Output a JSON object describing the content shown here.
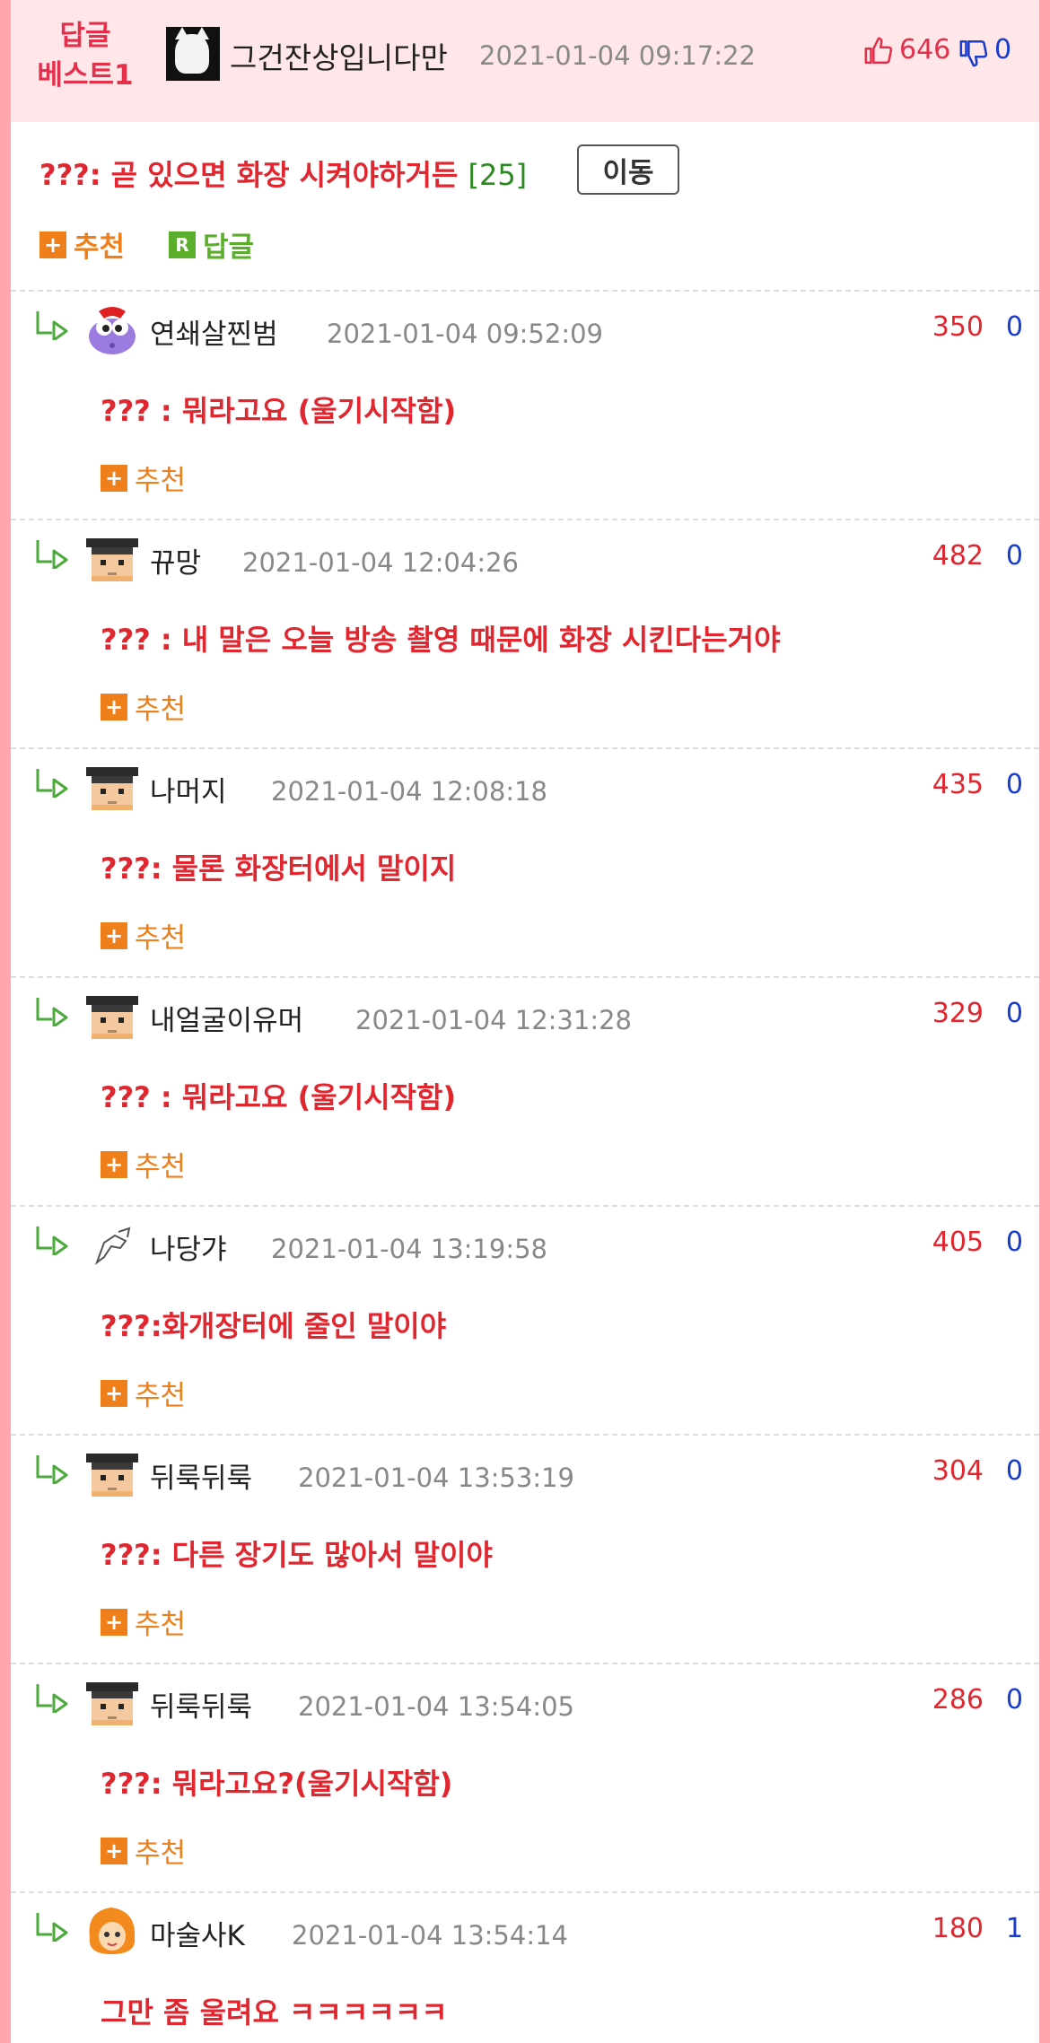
{
  "header": {
    "badge_line1": "답글",
    "badge_line2": "베스트1",
    "author": "그건잔상입니다만",
    "date": "2021-01-04 09:17:22",
    "up_count": "646",
    "down_count": "0"
  },
  "main": {
    "text": "???: 곧 있으면 화장 시켜야하거든",
    "count": "[25]",
    "move_label": "이동",
    "recommend_label": "추천",
    "reply_label": "답글",
    "plus_glyph": "+",
    "reply_glyph": "R"
  },
  "comments": [
    {
      "avatar": "purple-blob-avatar",
      "author": "연쇄살찐범",
      "date": "2021-01-04 09:52:09",
      "up": "350",
      "down": "0",
      "text": "??? : 뭐라고요 (울기시작함)",
      "recommend": "추천"
    },
    {
      "avatar": "graduate-avatar",
      "author": "뀨망",
      "date": "2021-01-04 12:04:26",
      "up": "482",
      "down": "0",
      "text": "??? : 내 말은 오늘 방송 촬영 때문에 화장 시킨다는거야",
      "recommend": "추천"
    },
    {
      "avatar": "graduate-avatar",
      "author": "나머지",
      "date": "2021-01-04 12:08:18",
      "up": "435",
      "down": "0",
      "text": "???: 물론 화장터에서 말이지",
      "recommend": "추천"
    },
    {
      "avatar": "graduate-avatar",
      "author": "내얼굴이유머",
      "date": "2021-01-04 12:31:28",
      "up": "329",
      "down": "0",
      "text": "??? : 뭐라고요 (울기시작함)",
      "recommend": "추천"
    },
    {
      "avatar": "sketch-avatar",
      "author": "나당갸",
      "date": "2021-01-04 13:19:58",
      "up": "405",
      "down": "0",
      "text": "???:화개장터에 줄인 말이야",
      "recommend": "추천"
    },
    {
      "avatar": "graduate-avatar",
      "author": "뒤룩뒤룩",
      "date": "2021-01-04 13:53:19",
      "up": "304",
      "down": "0",
      "text": "???: 다른 장기도 많아서 말이야",
      "recommend": "추천"
    },
    {
      "avatar": "graduate-avatar",
      "author": "뒤룩뒤룩",
      "date": "2021-01-04 13:54:05",
      "up": "286",
      "down": "0",
      "text": "???: 뭐라고요?(울기시작함)",
      "recommend": "추천"
    },
    {
      "avatar": "flame-hair-avatar",
      "author": "마술사K",
      "date": "2021-01-04 13:54:14",
      "up": "180",
      "down": "1",
      "text": "그만 좀 울려요 ㅋㅋㅋㅋㅋㅋ",
      "recommend": ""
    }
  ],
  "colors": {
    "page_border": "#ffa7ad",
    "header_bg": "#ffe6e8",
    "accent_red": "#e0262f",
    "orange": "#ef7f1a",
    "green": "#5aae2c",
    "blue": "#1a3ccc"
  }
}
